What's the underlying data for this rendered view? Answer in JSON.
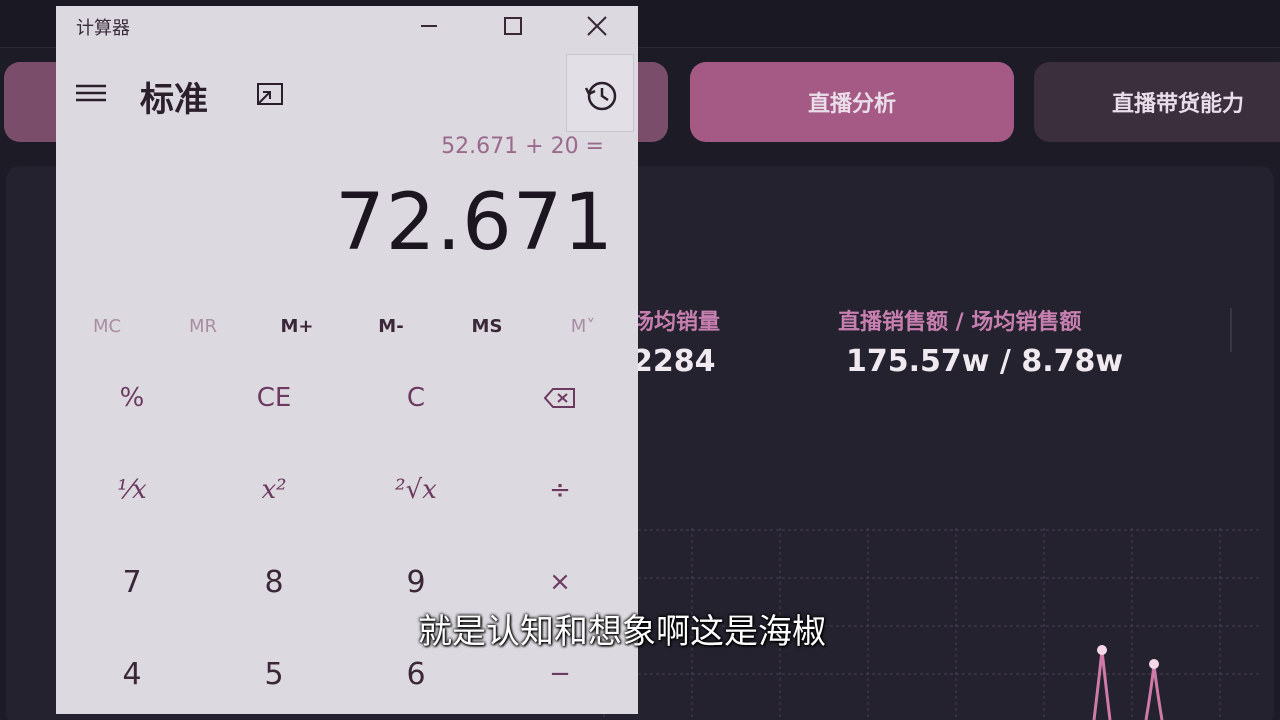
{
  "dashboard": {
    "tabs": {
      "left": "",
      "active": "直播分析",
      "right": "直播带货能力"
    },
    "stats": {
      "avg_sales_label": "场均销量",
      "avg_sales_value": "2284",
      "sales_amount_label": "直播销售额 / 场均销售额",
      "sales_amount_value": "175.57w / 8.78w"
    },
    "chart_data": {
      "type": "line",
      "title": "",
      "series": [
        {
          "values": [
            0,
            0,
            0,
            0,
            0,
            0,
            1,
            0.8
          ]
        }
      ]
    }
  },
  "calculator": {
    "window_title": "计算器",
    "mode": "标准",
    "expression": "52.671 + 20 =",
    "display": "72.671",
    "memory_buttons": [
      "MC",
      "MR",
      "M+",
      "M-",
      "MS",
      "M˅"
    ],
    "keys": {
      "percent": "%",
      "ce": "CE",
      "c": "C",
      "reciprocal": "⅟x",
      "square": "x²",
      "sqrt": "²√x",
      "divide": "÷",
      "seven": "7",
      "eight": "8",
      "nine": "9",
      "multiply": "×",
      "four": "4",
      "five": "5",
      "six": "6",
      "minus": "−"
    }
  },
  "subtitle": "就是认知和想象啊这是海椒"
}
